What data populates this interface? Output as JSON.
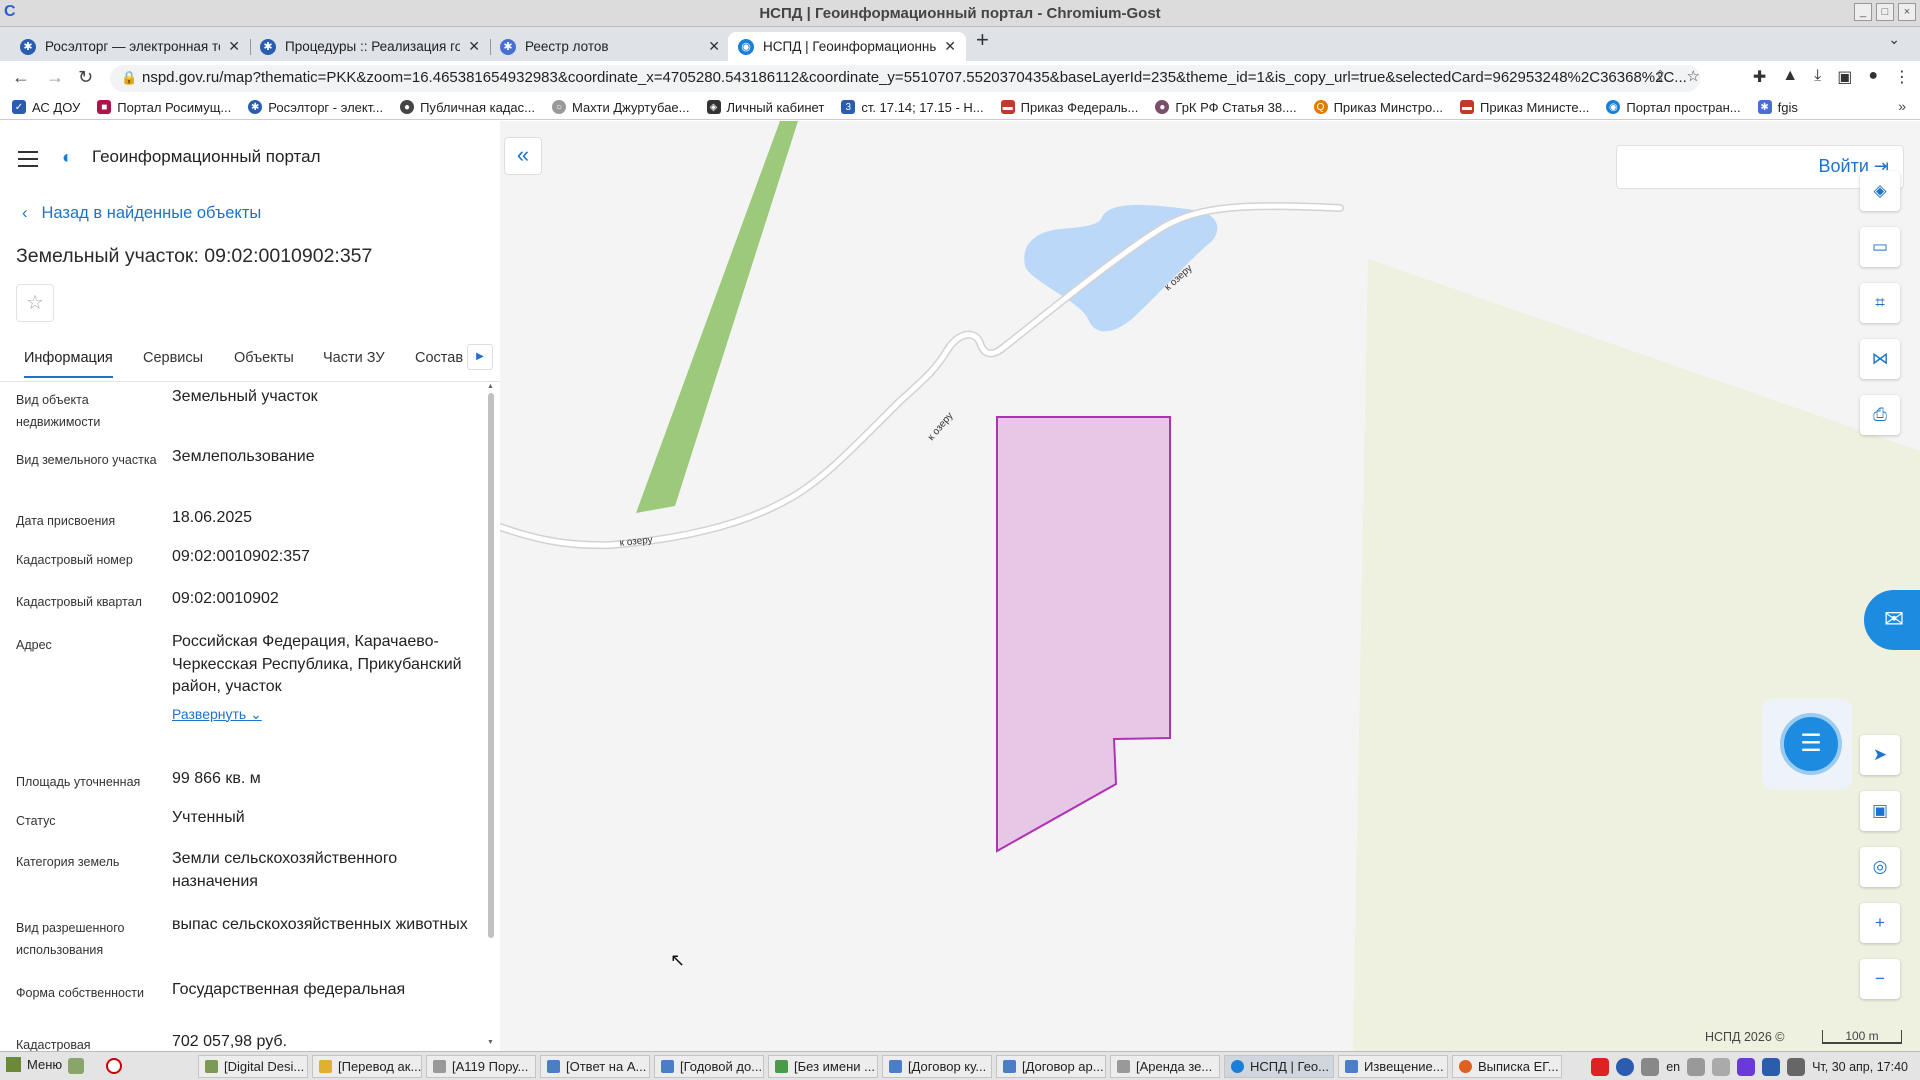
{
  "window": {
    "title": "НСПД | Геоинформационный портал - Chromium-Gost"
  },
  "tabs": [
    {
      "label": "Росэлторг — электронная тор",
      "color": "#2a5db0"
    },
    {
      "label": "Процедуры :: Реализация гос",
      "color": "#2a5db0"
    },
    {
      "label": "Реестр лотов",
      "color": "#4a6fd0"
    },
    {
      "label": "НСПД | Геоинформационный",
      "color": "#1a7fd8"
    }
  ],
  "address_bar": {
    "url": "nspd.gov.ru/map?thematic=PKK&zoom=16.465381654932983&coordinate_x=4705280.543186112&coordinate_y=5510707.5520370435&baseLayerId=235&theme_id=1&is_copy_url=true&selectedCard=962953248%2C36368%2C..."
  },
  "bookmarks": [
    {
      "label": "АС ДОУ",
      "color": "#2a5db0"
    },
    {
      "label": "Портал Росимущ...",
      "color": "#b0124a"
    },
    {
      "label": "Росэлторг - элект...",
      "color": "#2a5db0"
    },
    {
      "label": "Публичная кадас...",
      "color": "#444"
    },
    {
      "label": "Махти Джуртубае...",
      "color": "#999"
    },
    {
      "label": "Личный кабинет",
      "color": "#333"
    },
    {
      "label": "ст. 17.14; 17.15 - Н...",
      "color": "#2a5db0"
    },
    {
      "label": "Приказ Федераль...",
      "color": "#c0392b"
    },
    {
      "label": "ГрК РФ Статья 38....",
      "color": "#7a4f6e"
    },
    {
      "label": "Приказ Минстро...",
      "color": "#e07b00"
    },
    {
      "label": "Приказ Министе...",
      "color": "#c0392b"
    },
    {
      "label": "Портал простран...",
      "color": "#1a7fd8"
    },
    {
      "label": "fgis",
      "color": "#4a6fd0"
    }
  ],
  "sidebar": {
    "portal_name": "Геоинформационный портал",
    "back_link": "Назад в найденные объекты",
    "heading": "Земельный участок: 09:02:0010902:357",
    "tabs": [
      "Информация",
      "Сервисы",
      "Объекты",
      "Части ЗУ",
      "Состав"
    ],
    "properties": [
      {
        "key": "Вид объекта недвижимости",
        "value": "Земельный участок"
      },
      {
        "key": "Вид земельного участка",
        "value": "Землепользование"
      },
      {
        "key": "Дата присвоения",
        "value": "18.06.2025"
      },
      {
        "key": "Кадастровый номер",
        "value": "09:02:0010902:357"
      },
      {
        "key": "Кадастровый квартал",
        "value": "09:02:0010902"
      },
      {
        "key": "Адрес",
        "value": "Российская Федерация, Карачаево-Черкесская Республика, Прикубанский район, участок"
      },
      {
        "key": "Площадь уточненная",
        "value": "99 866 кв. м"
      },
      {
        "key": "Статус",
        "value": "Учтенный"
      },
      {
        "key": "Категория земель",
        "value": "Земли сельскохозяйственного назначения"
      },
      {
        "key": "Вид разрешенного использования",
        "value": "выпас сельскохозяйственных животных"
      },
      {
        "key": "Форма собственности",
        "value": "Государственная федеральная"
      },
      {
        "key": "Кадастровая",
        "value": "702 057,98 руб."
      }
    ],
    "expand_label": "Развернуть"
  },
  "map": {
    "login_label": "Войти",
    "road_labels": [
      "к озеру",
      "к озеру",
      "к озеру"
    ],
    "copyright": "НСПД 2026 ©",
    "scale": "100 m",
    "colors": {
      "parcel_fill": "#e6c8e6",
      "parcel_stroke": "#b030b8",
      "water": "#bcd8f8",
      "field": "#9cc97a",
      "zone": "#eef0e0"
    }
  },
  "taskbar": {
    "menu_label": "Меню",
    "items": [
      {
        "label": "[Digital Desi...",
        "color": "#7a9a55"
      },
      {
        "label": "[Перевод ак...",
        "color": "#e0b030"
      },
      {
        "label": "[А119 Пору...",
        "color": "#999"
      },
      {
        "label": "[Ответ на А...",
        "color": "#4a7fc8"
      },
      {
        "label": "[Годовой до...",
        "color": "#4a7fc8"
      },
      {
        "label": "[Без имени ...",
        "color": "#4a9a4a"
      },
      {
        "label": "[Договор ку...",
        "color": "#4a7fc8"
      },
      {
        "label": "[Договор ар...",
        "color": "#4a7fc8"
      },
      {
        "label": "[Аренда зе...",
        "color": "#999"
      },
      {
        "label": "НСПД | Гео...",
        "color": "#1a7fd8"
      },
      {
        "label": "Извещение...",
        "color": "#4a7fc8"
      },
      {
        "label": "Выписка ЕГ...",
        "color": "#e06020"
      }
    ],
    "lang": "en",
    "clock": "Чт, 30 апр, 17:40"
  }
}
